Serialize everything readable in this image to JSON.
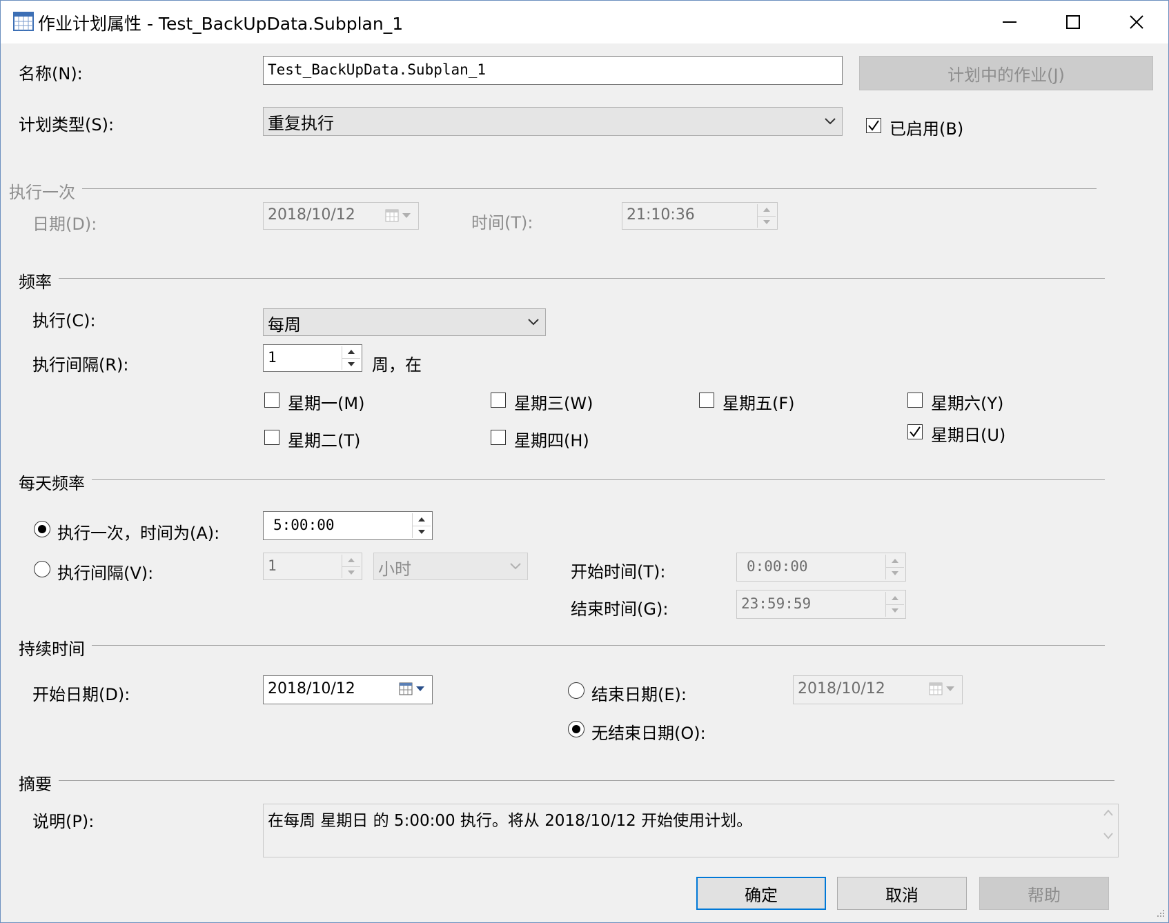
{
  "window": {
    "title": "作业计划属性 - Test_BackUpData.Subplan_1"
  },
  "form": {
    "name_label": "名称(N):",
    "name_value": "Test_BackUpData.Subplan_1",
    "jobs_in_schedule_button": "计划中的作业(J)",
    "schedule_type_label": "计划类型(S):",
    "schedule_type_value": "重复执行",
    "enabled_label": "已启用(B)"
  },
  "one_time": {
    "section": "执行一次",
    "date_label": "日期(D):",
    "date_value": "2018/10/12",
    "time_label": "时间(T):",
    "time_value": "21:10:36"
  },
  "frequency": {
    "section": "频率",
    "occurs_label": "执行(C):",
    "occurs_value": "每周",
    "recurs_label": "执行间隔(R):",
    "recurs_value": "1",
    "recurs_suffix": "周，在",
    "days": {
      "mon": "星期一(M)",
      "tue": "星期二(T)",
      "wed": "星期三(W)",
      "thu": "星期四(H)",
      "fri": "星期五(F)",
      "sat": "星期六(Y)",
      "sun": "星期日(U)"
    }
  },
  "daily": {
    "section": "每天频率",
    "once_label": "执行一次，时间为(A):",
    "once_value": "5:00:00",
    "every_label": "执行间隔(V):",
    "every_value": "1",
    "every_unit": "小时",
    "start_label": "开始时间(T):",
    "start_value": "0:00:00",
    "end_label": "结束时间(G):",
    "end_value": "23:59:59"
  },
  "duration": {
    "section": "持续时间",
    "start_label": "开始日期(D):",
    "start_value": "2018/10/12",
    "end_label": "结束日期(E):",
    "end_value": "2018/10/12",
    "no_end_label": "无结束日期(O):"
  },
  "summary": {
    "section": "摘要",
    "desc_label": "说明(P):",
    "desc_value": "在每周 星期日 的 5:00:00 执行。将从 2018/10/12 开始使用计划。"
  },
  "buttons": {
    "ok": "确定",
    "cancel": "取消",
    "help": "帮助"
  },
  "colors": {
    "accent": "#0078d7",
    "window_bg": "#f0f0f0",
    "disabled_text": "#8d8d8d"
  }
}
